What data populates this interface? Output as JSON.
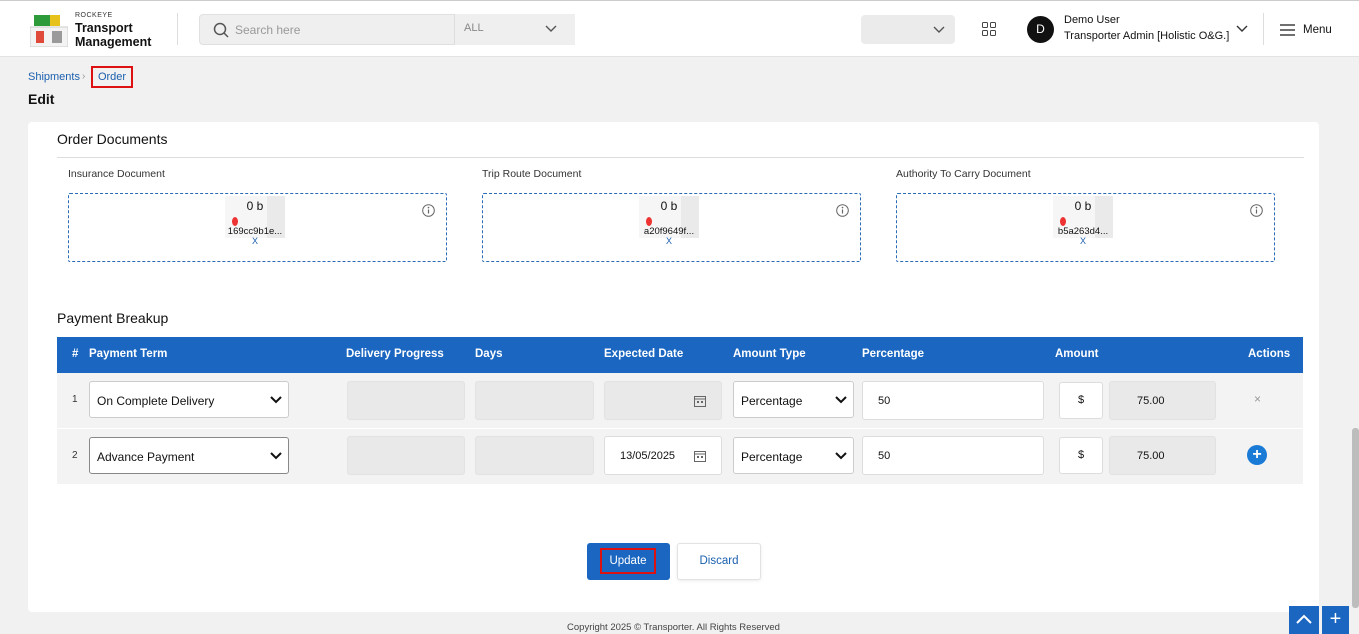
{
  "header": {
    "logo_small": "ROCKEYE",
    "logo_title_1": "Transport",
    "logo_title_2": "Management",
    "search_placeholder": "Search here",
    "search_scope": "ALL",
    "user_initial": "D",
    "user_name": "Demo User",
    "user_role": "Transporter Admin [Holistic O&G.]",
    "menu_label": "Menu"
  },
  "breadcrumb": {
    "parent": "Shipments",
    "current": "Order"
  },
  "page_title": "Edit",
  "documents": {
    "title": "Order Documents",
    "items": [
      {
        "label": "Insurance Document",
        "size": "0 b",
        "file": "169cc9b1e...",
        "remove": "X"
      },
      {
        "label": "Trip Route Document",
        "size": "0 b",
        "file": "a20f9649f...",
        "remove": "X"
      },
      {
        "label": "Authority To Carry Document",
        "size": "0 b",
        "file": "b5a263d4...",
        "remove": "X"
      }
    ]
  },
  "payment": {
    "title": "Payment Breakup",
    "columns": [
      "#",
      "Payment Term",
      "Delivery Progress",
      "Days",
      "Expected Date",
      "Amount Type",
      "Percentage",
      "Amount",
      "Actions"
    ],
    "rows": [
      {
        "num": "1",
        "term": "On Complete Delivery",
        "delivery_progress": "",
        "days": "",
        "expected_date": "",
        "amount_type": "Percentage",
        "percentage": "50",
        "currency": "$",
        "amount": "75.00",
        "action": "×"
      },
      {
        "num": "2",
        "term": "Advance Payment",
        "delivery_progress": "",
        "days": "",
        "expected_date": "13/05/2025",
        "amount_type": "Percentage",
        "percentage": "50",
        "currency": "$",
        "amount": "75.00",
        "action": "+"
      }
    ]
  },
  "buttons": {
    "update": "Update",
    "discard": "Discard"
  },
  "footer": "Copyright 2025 © Transporter. All Rights Reserved",
  "fab": {
    "plus": "+"
  },
  "colors": {
    "primary": "#1a66c0",
    "highlight": "#dd1111",
    "link": "#1b5fae"
  }
}
